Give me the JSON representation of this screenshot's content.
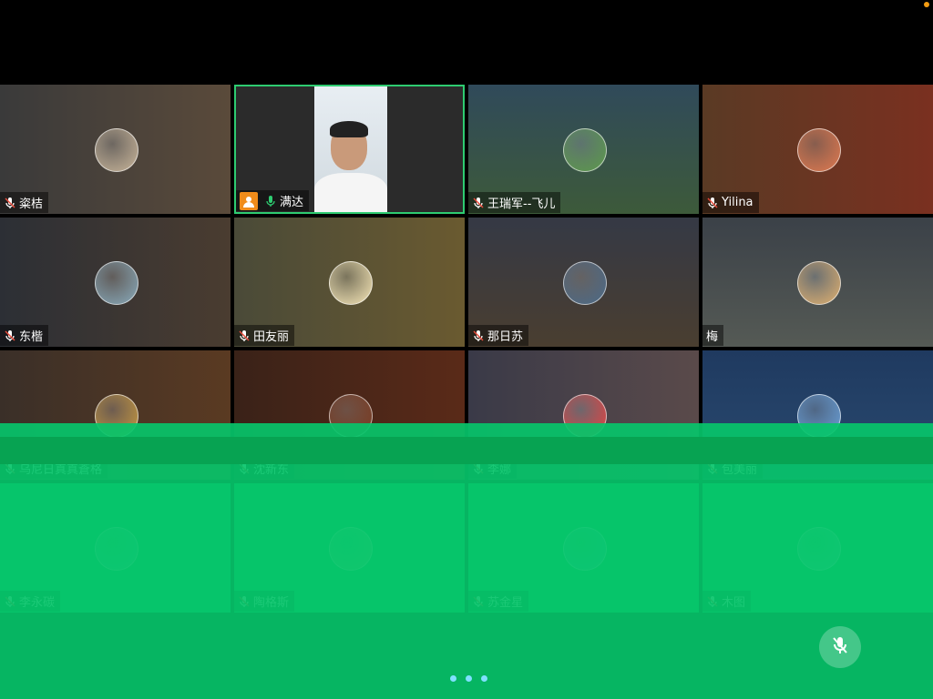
{
  "participants": [
    {
      "name": "粢桔",
      "muted": true,
      "bg": "linear-gradient(90deg,#3a3a3a,#5a4a3a)",
      "avatar": "#c8b59a"
    },
    {
      "name": "满达",
      "muted": false,
      "host": true,
      "video": true
    },
    {
      "name": "王瑞军--飞儿",
      "muted": true,
      "bg": "linear-gradient(#304a5a,#3d5a3a)",
      "avatar": "#5c9a4c"
    },
    {
      "name": "Yilina",
      "muted": true,
      "bg": "linear-gradient(90deg,#5a3a24,#7a3020)",
      "avatar": "#e07a50"
    },
    {
      "name": "东楷",
      "muted": true,
      "bg": "linear-gradient(90deg,#2c2f35,#4a3c30)",
      "avatar": "#8ab"
    },
    {
      "name": "田友丽",
      "muted": true,
      "bg": "linear-gradient(90deg,#4a4a38,#6a5a30)",
      "avatar": "#f5e6b8"
    },
    {
      "name": "那日苏",
      "muted": true,
      "bg": "linear-gradient(#353945,#4a3e30)",
      "avatar": "#4a6a8a"
    },
    {
      "name": "梅",
      "muted": false,
      "bg": "linear-gradient(#3b4148,#555a55)",
      "avatar": "#e0b070"
    },
    {
      "name": "乌尼日真真蒼格",
      "muted": true,
      "bg": "linear-gradient(90deg,#3a2f28,#5a3a22)",
      "avatar": "#c89a40"
    },
    {
      "name": "沈新东",
      "muted": true,
      "bg": "linear-gradient(90deg,#3a2218,#5a2a18)",
      "avatar": "#7a3a20"
    },
    {
      "name": "李娜",
      "muted": true,
      "bg": "linear-gradient(90deg,#3a3a48,#5a4a4a)",
      "avatar": "#e84040"
    },
    {
      "name": "包美丽",
      "muted": true,
      "bg": "linear-gradient(#1f3a60,#2a4a70)",
      "avatar": "#6aa0d8"
    },
    {
      "name": "李永碳",
      "muted": true,
      "bg": "#0cc46e",
      "avatar": "#50d0c0"
    },
    {
      "name": "陶格斯",
      "muted": true,
      "bg": "#0bc46a",
      "avatar": "#8ad08a"
    },
    {
      "name": "苏金星",
      "muted": true,
      "bg": "#0bc46a",
      "avatar": "#50c8d8"
    },
    {
      "name": "木图",
      "muted": true,
      "bg": "#0bc46a",
      "avatar": "#70d0c8"
    }
  ],
  "colors": {
    "active_border": "#2ecc71",
    "host_badge": "#f08c1a",
    "overlay": "#06c46a"
  },
  "pager": {
    "pages": 3
  }
}
